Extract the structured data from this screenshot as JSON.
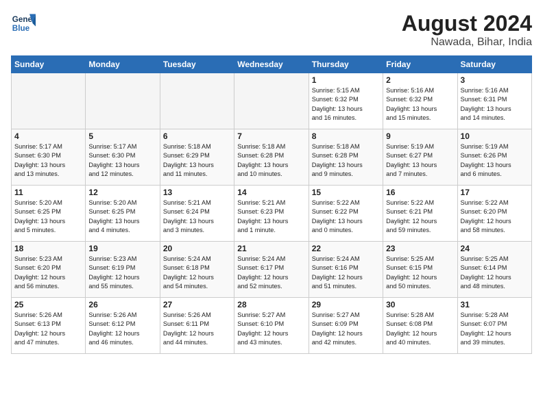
{
  "logo": {
    "line1": "General",
    "line2": "Blue"
  },
  "title": "August 2024",
  "location": "Nawada, Bihar, India",
  "headers": [
    "Sunday",
    "Monday",
    "Tuesday",
    "Wednesday",
    "Thursday",
    "Friday",
    "Saturday"
  ],
  "weeks": [
    [
      {
        "day": "",
        "info": "",
        "empty": true
      },
      {
        "day": "",
        "info": "",
        "empty": true
      },
      {
        "day": "",
        "info": "",
        "empty": true
      },
      {
        "day": "",
        "info": "",
        "empty": true
      },
      {
        "day": "1",
        "info": "Sunrise: 5:15 AM\nSunset: 6:32 PM\nDaylight: 13 hours\nand 16 minutes."
      },
      {
        "day": "2",
        "info": "Sunrise: 5:16 AM\nSunset: 6:32 PM\nDaylight: 13 hours\nand 15 minutes."
      },
      {
        "day": "3",
        "info": "Sunrise: 5:16 AM\nSunset: 6:31 PM\nDaylight: 13 hours\nand 14 minutes."
      }
    ],
    [
      {
        "day": "4",
        "info": "Sunrise: 5:17 AM\nSunset: 6:30 PM\nDaylight: 13 hours\nand 13 minutes."
      },
      {
        "day": "5",
        "info": "Sunrise: 5:17 AM\nSunset: 6:30 PM\nDaylight: 13 hours\nand 12 minutes."
      },
      {
        "day": "6",
        "info": "Sunrise: 5:18 AM\nSunset: 6:29 PM\nDaylight: 13 hours\nand 11 minutes."
      },
      {
        "day": "7",
        "info": "Sunrise: 5:18 AM\nSunset: 6:28 PM\nDaylight: 13 hours\nand 10 minutes."
      },
      {
        "day": "8",
        "info": "Sunrise: 5:18 AM\nSunset: 6:28 PM\nDaylight: 13 hours\nand 9 minutes."
      },
      {
        "day": "9",
        "info": "Sunrise: 5:19 AM\nSunset: 6:27 PM\nDaylight: 13 hours\nand 7 minutes."
      },
      {
        "day": "10",
        "info": "Sunrise: 5:19 AM\nSunset: 6:26 PM\nDaylight: 13 hours\nand 6 minutes."
      }
    ],
    [
      {
        "day": "11",
        "info": "Sunrise: 5:20 AM\nSunset: 6:25 PM\nDaylight: 13 hours\nand 5 minutes."
      },
      {
        "day": "12",
        "info": "Sunrise: 5:20 AM\nSunset: 6:25 PM\nDaylight: 13 hours\nand 4 minutes."
      },
      {
        "day": "13",
        "info": "Sunrise: 5:21 AM\nSunset: 6:24 PM\nDaylight: 13 hours\nand 3 minutes."
      },
      {
        "day": "14",
        "info": "Sunrise: 5:21 AM\nSunset: 6:23 PM\nDaylight: 13 hours\nand 1 minute."
      },
      {
        "day": "15",
        "info": "Sunrise: 5:22 AM\nSunset: 6:22 PM\nDaylight: 13 hours\nand 0 minutes."
      },
      {
        "day": "16",
        "info": "Sunrise: 5:22 AM\nSunset: 6:21 PM\nDaylight: 12 hours\nand 59 minutes."
      },
      {
        "day": "17",
        "info": "Sunrise: 5:22 AM\nSunset: 6:20 PM\nDaylight: 12 hours\nand 58 minutes."
      }
    ],
    [
      {
        "day": "18",
        "info": "Sunrise: 5:23 AM\nSunset: 6:20 PM\nDaylight: 12 hours\nand 56 minutes."
      },
      {
        "day": "19",
        "info": "Sunrise: 5:23 AM\nSunset: 6:19 PM\nDaylight: 12 hours\nand 55 minutes."
      },
      {
        "day": "20",
        "info": "Sunrise: 5:24 AM\nSunset: 6:18 PM\nDaylight: 12 hours\nand 54 minutes."
      },
      {
        "day": "21",
        "info": "Sunrise: 5:24 AM\nSunset: 6:17 PM\nDaylight: 12 hours\nand 52 minutes."
      },
      {
        "day": "22",
        "info": "Sunrise: 5:24 AM\nSunset: 6:16 PM\nDaylight: 12 hours\nand 51 minutes."
      },
      {
        "day": "23",
        "info": "Sunrise: 5:25 AM\nSunset: 6:15 PM\nDaylight: 12 hours\nand 50 minutes."
      },
      {
        "day": "24",
        "info": "Sunrise: 5:25 AM\nSunset: 6:14 PM\nDaylight: 12 hours\nand 48 minutes."
      }
    ],
    [
      {
        "day": "25",
        "info": "Sunrise: 5:26 AM\nSunset: 6:13 PM\nDaylight: 12 hours\nand 47 minutes."
      },
      {
        "day": "26",
        "info": "Sunrise: 5:26 AM\nSunset: 6:12 PM\nDaylight: 12 hours\nand 46 minutes."
      },
      {
        "day": "27",
        "info": "Sunrise: 5:26 AM\nSunset: 6:11 PM\nDaylight: 12 hours\nand 44 minutes."
      },
      {
        "day": "28",
        "info": "Sunrise: 5:27 AM\nSunset: 6:10 PM\nDaylight: 12 hours\nand 43 minutes."
      },
      {
        "day": "29",
        "info": "Sunrise: 5:27 AM\nSunset: 6:09 PM\nDaylight: 12 hours\nand 42 minutes."
      },
      {
        "day": "30",
        "info": "Sunrise: 5:28 AM\nSunset: 6:08 PM\nDaylight: 12 hours\nand 40 minutes."
      },
      {
        "day": "31",
        "info": "Sunrise: 5:28 AM\nSunset: 6:07 PM\nDaylight: 12 hours\nand 39 minutes."
      }
    ]
  ]
}
